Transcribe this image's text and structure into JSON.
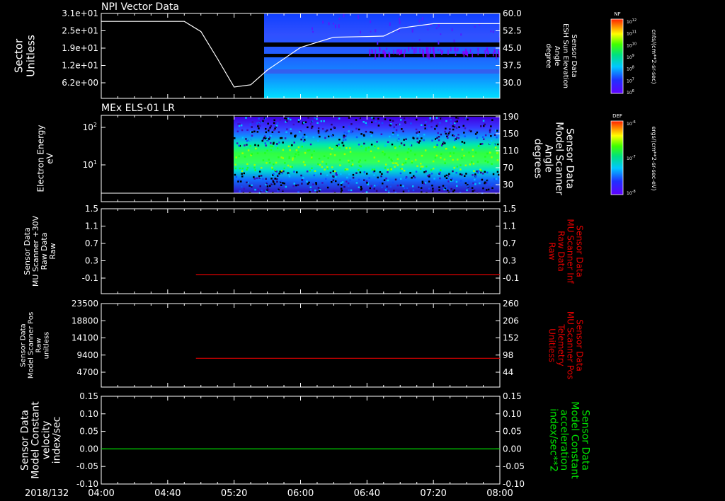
{
  "date_label": "2018/132",
  "time_ticks": [
    "04:00",
    "04:40",
    "05:20",
    "06:00",
    "06:40",
    "07:20",
    "08:00"
  ],
  "colors": {
    "white": "#ffffff",
    "red": "#e00000",
    "green": "#00e000",
    "bg": "#000000"
  },
  "chart_data": [
    {
      "type": "heatmap",
      "title": "NPI Vector Data",
      "ylabel": "Sector\nUnitless",
      "y_ticks": [
        "3.1e+01",
        "2.5e+01",
        "1.9e+01",
        "1.2e+01",
        "6.2e+00"
      ],
      "right_ylabel": "Sensor Data\nESH Sun Elevation\nAngle\ndegree",
      "right_ticks": [
        "60.0",
        "52.5",
        "45.0",
        "37.5",
        "30.0"
      ],
      "data_start": "05:10",
      "overlay_line": {
        "name": "ESH Sun Elevation Angle",
        "x": [
          "04:00",
          "04:50",
          "05:00",
          "05:10",
          "05:20",
          "05:30",
          "05:40",
          "06:00",
          "06:20",
          "06:40",
          "06:50",
          "07:00",
          "07:20",
          "08:00"
        ],
        "y": [
          56.5,
          56.5,
          52.0,
          40.0,
          27.5,
          28.5,
          35.0,
          45.0,
          49.5,
          49.8,
          50.0,
          53.5,
          55.5,
          55.5
        ]
      },
      "colorbar": {
        "label": "NF",
        "units": "cnts/(cm**2-sr-sec)",
        "ticks": [
          "10^12",
          "10^11",
          "10^10",
          "10^9",
          "10^8",
          "10^7",
          "10^6"
        ]
      }
    },
    {
      "type": "heatmap",
      "title": "MEx ELS-01 LR",
      "ylabel": "Electron Energy\neV",
      "y_ticks": [
        "10^2",
        "10^1"
      ],
      "right_ylabel": "Sensor Data\nModel Scanner\nAngle\ndegrees",
      "right_ticks": [
        "190",
        "150",
        "110",
        "70",
        "30"
      ],
      "data_start": "04:59",
      "colorbar": {
        "label": "DEF",
        "units": "ergs/(cm**2-sr-sec-eV)",
        "ticks": [
          "10^-6",
          "10^-7",
          "10^-8"
        ]
      }
    },
    {
      "type": "line",
      "ylabel": "Sensor Data\nMU Scanner +30V\nRaw Data\nRaw",
      "y_ticks": [
        "1.5",
        "1.1",
        "0.7",
        "0.3",
        "-0.1"
      ],
      "right_ylabel": "Sensor Data\nMU Scanner Inf\nRaw Data\nRaw",
      "right_ticks": [
        "1.5",
        "1.1",
        "0.7",
        "0.3",
        "-0.1"
      ],
      "ylim": [
        -0.5,
        1.5
      ],
      "series": [
        {
          "x_start": "04:57",
          "x_end": "08:00",
          "y": -0.05
        }
      ]
    },
    {
      "type": "line",
      "ylabel": "Sensor Data\nModel Scanner Pos\nRaw\nunitless",
      "y_ticks": [
        "23500",
        "18800",
        "14100",
        "9400",
        "4700"
      ],
      "right_ylabel": "Sensor Data\nMU Scanner Pos\nTelemetry\nUnitless",
      "right_ticks": [
        "260",
        "206",
        "152",
        "98",
        "44"
      ],
      "ylim": [
        0,
        23500
      ],
      "series": [
        {
          "x_start": "04:57",
          "x_end": "08:00",
          "y": 8100
        }
      ]
    },
    {
      "type": "line",
      "ylabel": "Sensor Data\nModel Constant\nvelocity\nindex/sec",
      "y_ticks": [
        "0.15",
        "0.10",
        "0.05",
        "0.00",
        "-0.05",
        "-0.10"
      ],
      "right_ylabel": "Sensor Data\nModel Constant\nacceleration\nindex/sec**2",
      "right_ticks": [
        "0.15",
        "0.10",
        "0.05",
        "0.00",
        "-0.05",
        "-0.10"
      ],
      "ylim": [
        -0.1,
        0.15
      ],
      "series": [
        {
          "x_start": "04:00",
          "x_end": "08:00",
          "y": 0.0
        }
      ]
    }
  ]
}
